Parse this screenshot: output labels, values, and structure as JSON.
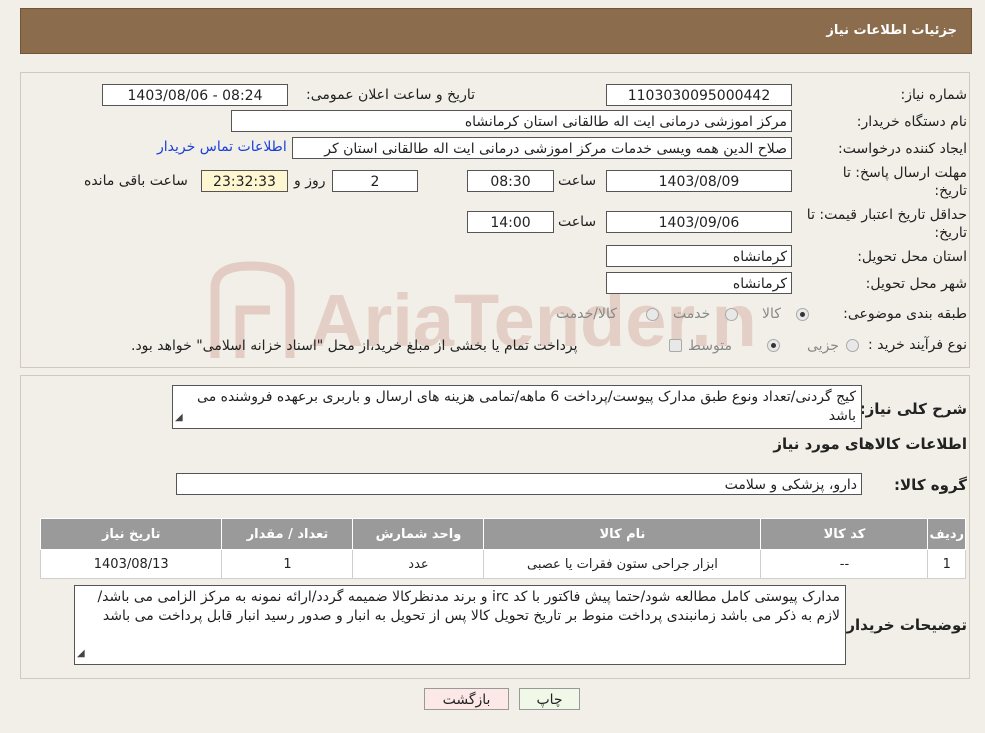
{
  "header": {
    "title": "جزئیات اطلاعات نیاز"
  },
  "form": {
    "need_number_label": "شماره نیاز:",
    "need_number": "1103030095000442",
    "announce_label": "تاریخ و ساعت اعلان عمومی:",
    "announce_value": "1403/08/06 - 08:24",
    "buyer_org_label": "نام دستگاه خریدار:",
    "buyer_org": "مرکز اموزشی درمانی ایت اله طالقانی استان کرمانشاه",
    "creator_label": "ایجاد کننده درخواست:",
    "creator": "صلاح الدین همه ویسی خدمات مرکز اموزشی درمانی ایت اله طالقانی استان کر",
    "contact_link": "اطلاعات تماس خریدار",
    "reply_deadline_label_1": "مهلت ارسال پاسخ: تا",
    "reply_deadline_label_2": "تاریخ:",
    "reply_date": "1403/08/09",
    "time_label": "ساعت",
    "reply_time": "08:30",
    "days": "2",
    "days_label": "روز و",
    "remaining": "23:32:33",
    "remaining_label": "ساعت باقی مانده",
    "price_validity_label_1": "حداقل تاریخ اعتبار قیمت: تا",
    "price_validity_label_2": "تاریخ:",
    "price_date": "1403/09/06",
    "price_time": "14:00",
    "province_label": "استان محل تحویل:",
    "province": "کرمانشاه",
    "city_label": "شهر محل تحویل:",
    "city": "کرمانشاه",
    "category_label": "طبقه بندی موضوعی:",
    "category_options": [
      "کالا",
      "خدمت",
      "کالا/خدمت"
    ],
    "process_label": "نوع فرآیند خرید :",
    "process_options": [
      "جزیی",
      "متوسط"
    ],
    "process_note": "پرداخت تمام یا بخشی از مبلغ خرید،از محل \"اسناد خزانه اسلامی\" خواهد بود."
  },
  "summary": {
    "label": "شرح کلی نیاز:",
    "text": "کیج گردنی/تعداد ونوع طبق مدارک پیوست/پرداخت 6 ماهه/تمامی هزینه های ارسال و باربری برعهده فروشنده می باشد",
    "items_heading": "اطلاعات کالاهای مورد نیاز",
    "group_label": "گروه کالا:",
    "group_value": "دارو، پزشکی و سلامت"
  },
  "table": {
    "headers": [
      "ردیف",
      "کد کالا",
      "نام کالا",
      "واحد شمارش",
      "تعداد / مقدار",
      "تاریخ نیاز"
    ],
    "rows": [
      [
        "1",
        "--",
        "ابزار جراحی ستون فقرات یا عصبی",
        "عدد",
        "1",
        "1403/08/13"
      ]
    ]
  },
  "buyer_notes": {
    "label": "توضیحات خریدار:",
    "text": "مدارک پیوستی کامل مطالعه شود/حتما پیش فاکتور با کد irc و برند مدنظرکالا ضمیمه گردد/ارائه نمونه به مرکز الزامی می باشد/لازم به ذکر می باشد زمانبندی پرداخت منوط بر تاریخ تحویل کالا  پس از تحویل به انبار و صدور رسید انبار قابل پرداخت می باشد"
  },
  "buttons": {
    "print": "چاپ",
    "back": "بازگشت"
  },
  "watermark": {
    "text": "AriaTender.neT",
    "color": "#d9b0a6"
  }
}
